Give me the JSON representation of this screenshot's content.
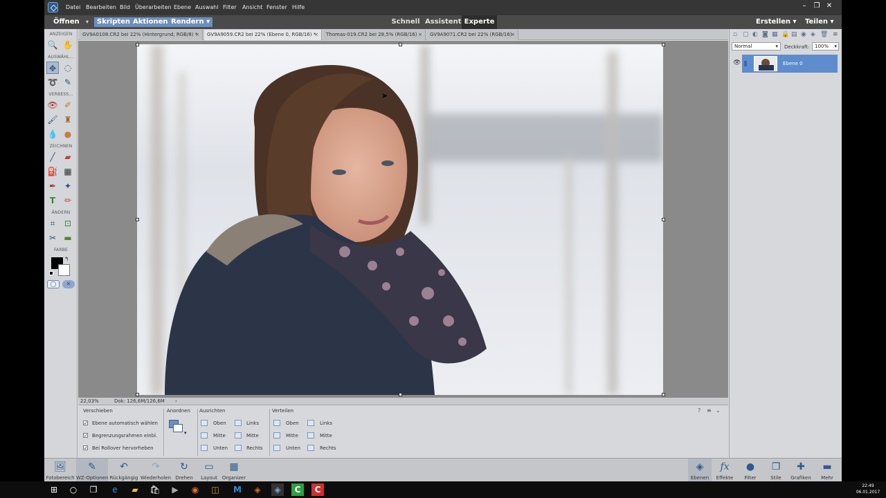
{
  "menubar": {
    "items": [
      "Datei",
      "Bearbeiten",
      "Bild",
      "Überarbeiten",
      "Ebene",
      "Auswahl",
      "Filter",
      "Ansicht",
      "Fenster",
      "Hilfe"
    ]
  },
  "modebar": {
    "open": "Öffnen",
    "scripts": "Skripten",
    "actions": "Aktionen",
    "render": "Rendern",
    "modes": [
      "Schnell",
      "Assistent",
      "Experte"
    ],
    "active_mode": "Experte",
    "create": "Erstellen",
    "share": "Teilen"
  },
  "tools": {
    "sections": [
      "ANZEIGEN",
      "AUSWÄHL...",
      "VERBESS...",
      "ZEICHNEN",
      "ÄNDERN",
      "FARBE"
    ]
  },
  "doc_tabs": [
    {
      "label": "GV9A0108.CR2 bei 22% (Hintergrund, RGB/8) *",
      "close": "×"
    },
    {
      "label": "GV9A9059.CR2 bei 22% (Ebene 0, RGB/16) *",
      "close": "×"
    },
    {
      "label": "Thomas-019.CR2 bei 28,5% (RGB/16)",
      "close": "×"
    },
    {
      "label": "GV9A9071.CR2 bei 22% (RGB/16)",
      "close": "×"
    }
  ],
  "status": {
    "zoom": "22,03%",
    "doc": "Dok: 126,6M/126,6M"
  },
  "options": {
    "move_title": "Verschieben",
    "checkboxes": [
      "Ebene automatisch wählen",
      "Begrenzungsrahmen einbl.",
      "Bei Rollover hervorheben"
    ],
    "arrange_title": "Anordnen",
    "align_title": "Ausrichten",
    "align_items": [
      "Oben",
      "Mitte",
      "Unten",
      "Links",
      "Mitte",
      "Rechts"
    ],
    "distribute_title": "Verteilen",
    "distribute_items": [
      "Oben",
      "Mitte",
      "Unten",
      "Links",
      "Mitte",
      "Rechts"
    ]
  },
  "layers": {
    "blend_mode": "Normal",
    "opacity_label": "Deckkraft:",
    "opacity_value": "100%",
    "layer_name": "Ebene 0"
  },
  "bottombar": {
    "left": [
      "Fotobereich",
      "WZ-Optionen",
      "Rückgängig",
      "Wiederholen",
      "Drehen",
      "Layout",
      "Organizer"
    ],
    "right": [
      "Ebenen",
      "Effekte",
      "Filter",
      "Stile",
      "Grafiken",
      "Mehr"
    ]
  },
  "taskbar": {
    "time": "22:49",
    "date": "06.01.2017"
  }
}
